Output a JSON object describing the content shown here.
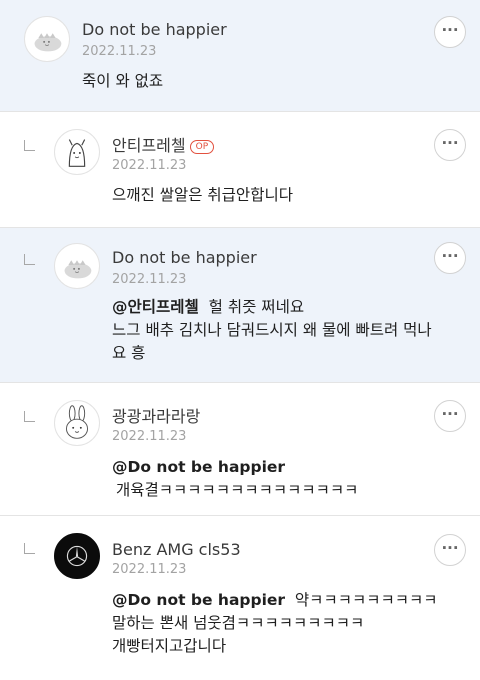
{
  "comments": [
    {
      "author": "Do not be happier",
      "date": "2022.11.23",
      "text": "죽이 와 없죠",
      "more": "···"
    },
    {
      "author": "안티프레첼",
      "badge": "OP",
      "date": "2022.11.23",
      "text": "으깨진 쌀알은 취급안합니다",
      "more": "···"
    },
    {
      "author": "Do not be happier",
      "date": "2022.11.23",
      "mention": "@안티프레첼",
      "line1": "헐 취즛 쩌네요",
      "line2": "느그 배추 김치나 담궈드시지 왜 물에 빠트려 먹나",
      "line3": "요 흥",
      "more": "···"
    },
    {
      "author": "광광과라라랑",
      "date": "2022.11.23",
      "mention": "@Do not be happier",
      "line1": "개육결ㅋㅋㅋㅋㅋㅋㅋㅋㅋㅋㅋㅋㅋㅋ",
      "more": "···"
    },
    {
      "author": "Benz AMG cls53",
      "date": "2022.11.23",
      "mention": "@Do not be happier",
      "line1": "약ㅋㅋㅋㅋㅋㅋㅋㅋㅋ",
      "line2": "말하는 뽄새 넘웃겸ㅋㅋㅋㅋㅋㅋㅋㅋㅋ",
      "line3": "개빵터지고갑니다",
      "more": "···"
    }
  ]
}
